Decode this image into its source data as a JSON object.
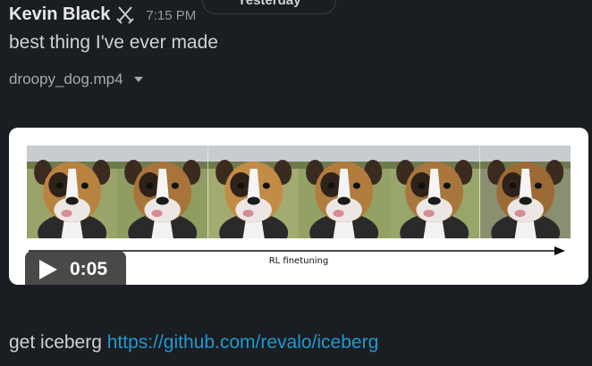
{
  "day_divider": {
    "label": "Yesterday"
  },
  "message": {
    "sender": "Kevin Black",
    "status_icon": "crossed-swords-icon",
    "time": "7:15 PM",
    "text": "best thing I've ever made"
  },
  "attachment": {
    "filename": "droopy_dog.mp4",
    "expand_icon": "caret-down-icon",
    "video": {
      "caption": "RL finetuning",
      "duration": "0:05",
      "frame_count": 6
    }
  },
  "message2": {
    "prefix": "get iceberg ",
    "link_text": "https://github.com/revalo/iceberg"
  },
  "colors": {
    "background": "#1a1d21",
    "link": "#1d9bd1",
    "text": "#d1d2d3"
  }
}
